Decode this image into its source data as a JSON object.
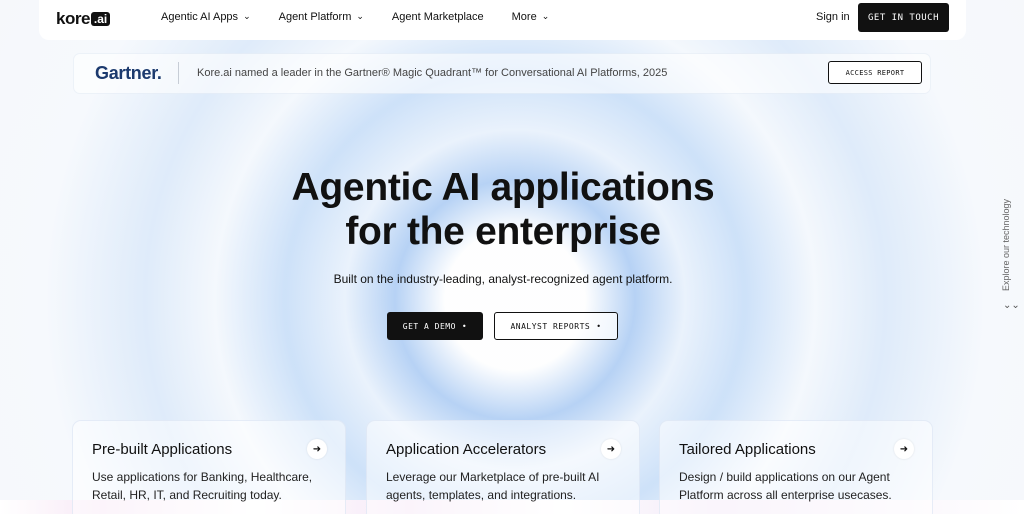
{
  "nav": {
    "logo_text": "kore",
    "logo_box": ".ai",
    "menu": [
      {
        "label": "Agentic AI Apps",
        "has_dropdown": true
      },
      {
        "label": "Agent Platform",
        "has_dropdown": true
      },
      {
        "label": "Agent Marketplace",
        "has_dropdown": false
      },
      {
        "label": "More",
        "has_dropdown": true
      }
    ],
    "signin": "Sign in",
    "cta": "GET IN TOUCH"
  },
  "banner": {
    "brand": "Gartner.",
    "text": "Kore.ai named a leader in the Gartner® Magic Quadrant™ for Conversational AI Platforms, 2025",
    "button": "ACCESS REPORT"
  },
  "hero": {
    "title_line1": "Agentic AI applications",
    "title_line2": "for the enterprise",
    "subtitle": "Built on the industry-leading, analyst-recognized agent platform.",
    "primary_button": "GET A DEMO",
    "secondary_button": "ANALYST REPORTS",
    "button_dot": "•"
  },
  "side": {
    "explore": "Explore our technology",
    "chevron": "⌄⌄"
  },
  "cards": [
    {
      "title": "Pre-built Applications",
      "desc": "Use applications for Banking, Healthcare, Retail, HR, IT, and Recruiting today."
    },
    {
      "title": "Application Accelerators",
      "desc": "Leverage our Marketplace of pre-built AI agents, templates, and integrations."
    },
    {
      "title": "Tailored Applications",
      "desc": "Design / build applications on our Agent Platform across all enterprise usecases."
    }
  ],
  "icons": {
    "chevron": "chevron-down-icon",
    "arrow": "arrow-right-icon"
  },
  "colors": {
    "primary": "#111111",
    "gartner": "#1c3a6e",
    "background": "#f3f7fb"
  }
}
